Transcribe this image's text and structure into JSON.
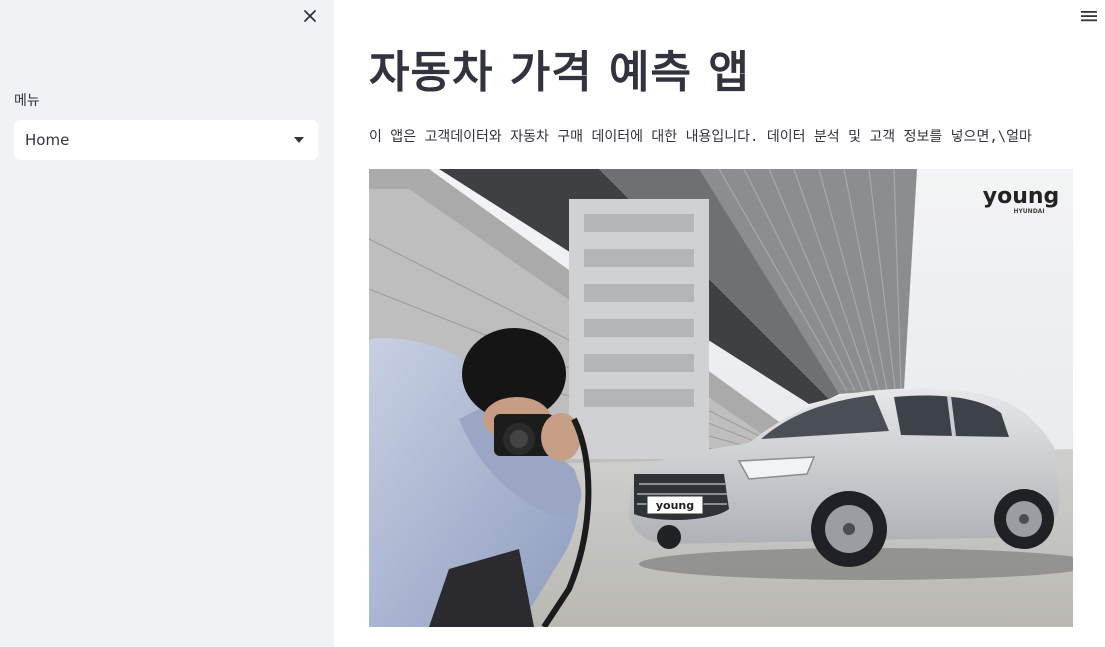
{
  "sidebar": {
    "menu_label": "메뉴",
    "select": {
      "selected": "Home"
    }
  },
  "main": {
    "title": "자동차 가격 예측 앱",
    "intro_text": "이 앱은 고객데이터와 자동차 구매 데이터에 대한 내용입니다. 데이터 분석 및 고객 정보를 넣으면,\\얼마",
    "hero_image": {
      "logo_text": "young",
      "logo_subtext": "HYUNDAI",
      "plate_text": "young"
    }
  },
  "colors": {
    "sidebar_bg": "#f0f2f6",
    "text": "#31333f",
    "car_silver": "#c9ccd0"
  },
  "icons": {
    "close": "close-icon",
    "menu": "hamburger-menu-icon",
    "dropdown": "chevron-down-icon"
  }
}
